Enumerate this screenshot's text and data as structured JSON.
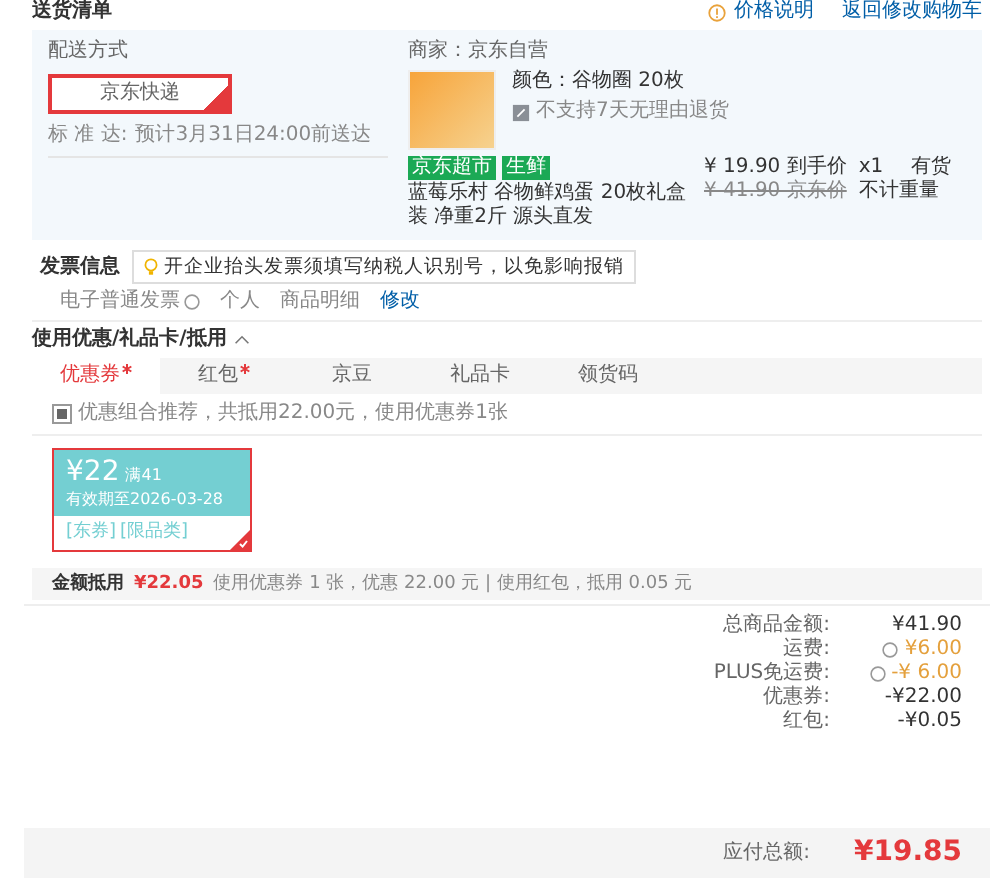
{
  "header": {
    "title": "送货清单",
    "price_note": "价格说明",
    "back_link": "返回修改购物车"
  },
  "shipping": {
    "label": "配送方式",
    "options": [
      {
        "text": "京东快递",
        "selected": true
      }
    ],
    "schedule_label": "标 准 达:",
    "schedule": "预计3月31日24:00前送达"
  },
  "shop": {
    "seller": "商家：京东自营",
    "variant": "颜色：谷物圈 20枚",
    "return_policy": "不支持7天无理由退货",
    "tags": [
      "京东超市",
      "生鲜"
    ],
    "title": "蓝莓乐村 谷物鲜鸡蛋 20枚礼盒装 净重2斤 源头直发",
    "price": "¥ 19.90 到手价",
    "orig_price": "¥ 41.90 京东价",
    "quantity": "x1",
    "stock": "有货",
    "weight": "不计重量"
  },
  "invoice": {
    "title": "发票信息",
    "tip": "开企业抬头发票须填写纳税人识别号，以免影响报销",
    "type": "电子普通发票",
    "holder": "个人",
    "content": "商品明细",
    "edit": "修改"
  },
  "discounts": {
    "title": "使用优惠/礼品卡/抵用",
    "expanded": true,
    "tabs": [
      {
        "label": "优惠券",
        "marked": true,
        "selected": true
      },
      {
        "label": "红包",
        "marked": true,
        "selected": false
      },
      {
        "label": "京豆",
        "marked": false,
        "selected": false
      },
      {
        "label": "礼品卡",
        "marked": false,
        "selected": false
      },
      {
        "label": "领货码",
        "marked": false,
        "selected": false
      }
    ],
    "recommend": {
      "checked": true,
      "text": "优惠组合推荐，共抵用22.00元，使用优惠券1张"
    },
    "coupons": [
      {
        "amount": "¥22",
        "condition": "满41",
        "validity": "有效期至2026-03-28",
        "tags": [
          "[东券]",
          "[限品类]"
        ],
        "selected": true
      }
    ],
    "summary_label": "金额抵用",
    "summary_amount": "¥22.05",
    "summary_detail": "使用优惠券 1 张，优惠 22.00 元 | 使用红包，抵用 0.05 元"
  },
  "totals": {
    "rows": [
      {
        "label": "总商品金额:",
        "value": "¥41.90",
        "info": false,
        "kind": "plain"
      },
      {
        "label": "运费:",
        "value": "¥6.00",
        "info": true,
        "kind": "highlight"
      },
      {
        "label": "PLUS免运费:",
        "value": "-¥ 6.00",
        "info": true,
        "kind": "highlight"
      },
      {
        "label": "优惠券:",
        "value": "-¥22.00",
        "info": false,
        "kind": "plain"
      },
      {
        "label": "红包:",
        "value": "-¥0.05",
        "info": false,
        "kind": "plain"
      }
    ],
    "due_label": "应付总额:",
    "due": "¥19.85"
  }
}
